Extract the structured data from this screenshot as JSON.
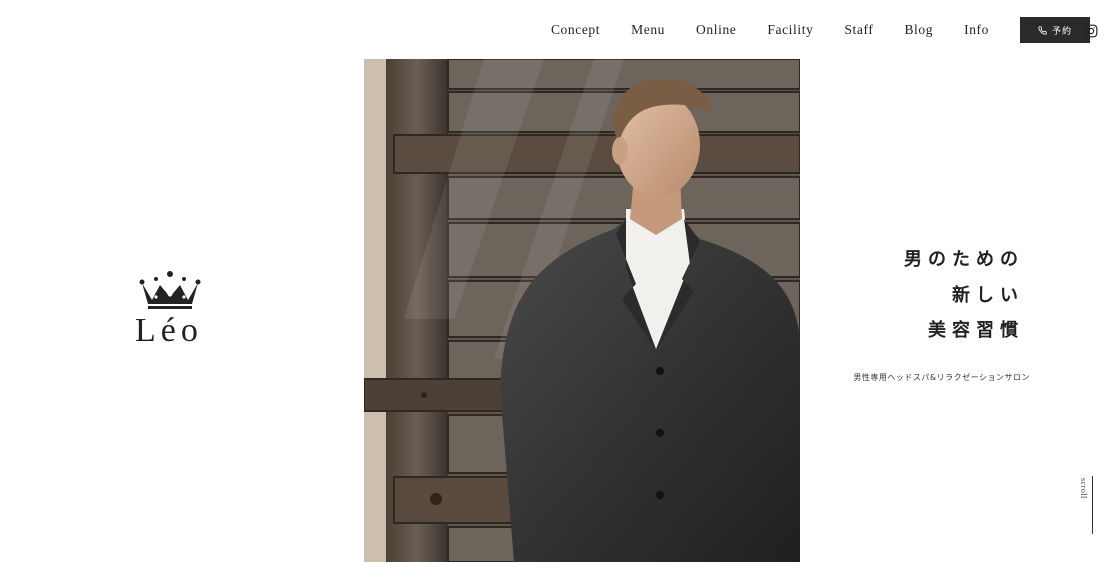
{
  "nav": {
    "items": [
      "Concept",
      "Menu",
      "Online",
      "Facility",
      "Staff",
      "Blog",
      "Info"
    ],
    "reserve_label": "予約",
    "reserve_icon": "phone-icon",
    "social_icon": "instagram-icon"
  },
  "logo": {
    "text": "Léo",
    "icon": "crown-icon"
  },
  "hero": {
    "catch_lines": [
      "男のための",
      "新しい",
      "美容習慣"
    ],
    "subtitle": "男性専用ヘッドスパ&リラクゼーションサロン"
  },
  "scroll": {
    "label": "scroll"
  },
  "colors": {
    "text": "#222222",
    "button_bg": "#2a2a2a",
    "background": "#ffffff"
  }
}
